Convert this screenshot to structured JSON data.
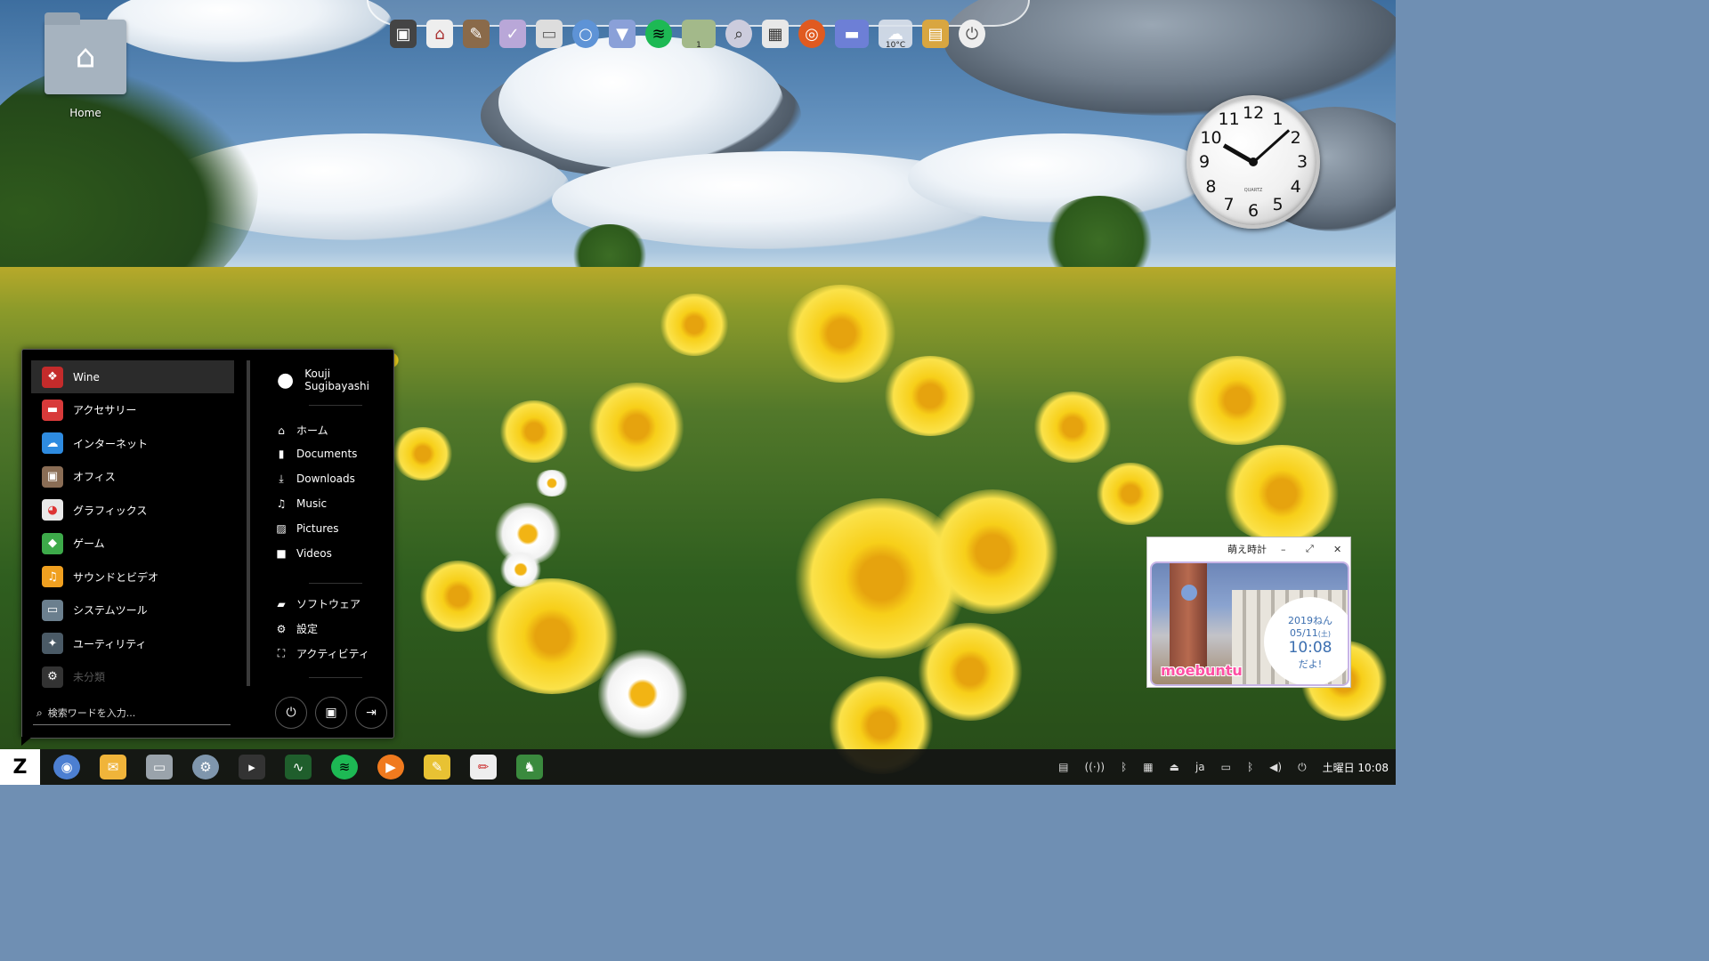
{
  "desktop": {
    "home_label": "Home",
    "home_icon": "house-icon"
  },
  "dock": {
    "weather_temp": "10°C",
    "workspace_number": "1",
    "icons": [
      "screenshot-icon",
      "home-icon",
      "gimp-icon",
      "tasks-icon",
      "hdd-icon",
      "search-icon",
      "shield-icon",
      "spotify-icon",
      "workspace-icon",
      "magnifier-icon",
      "calendar-icon",
      "ubuntu-icon",
      "panel-icon",
      "weather-icon",
      "archive-icon",
      "power-icon"
    ]
  },
  "analog_clock": {
    "numerals": [
      "12",
      "1",
      "2",
      "3",
      "4",
      "5",
      "6",
      "7",
      "8",
      "9",
      "10",
      "11"
    ],
    "brand": "QUARTZ"
  },
  "app_menu": {
    "categories": [
      {
        "label": "Wine",
        "icon": "wine-icon",
        "color": "#c42b2b"
      },
      {
        "label": "アクセサリー",
        "icon": "accessories-icon",
        "color": "#d83a3a"
      },
      {
        "label": "インターネット",
        "icon": "internet-cloud-icon",
        "color": "#2e8be0"
      },
      {
        "label": "オフィス",
        "icon": "office-briefcase-icon",
        "color": "#8a6d55"
      },
      {
        "label": "グラフィックス",
        "icon": "graphics-palette-icon",
        "color": "#e9e9e9"
      },
      {
        "label": "ゲーム",
        "icon": "game-controller-icon",
        "color": "#3daa4a"
      },
      {
        "label": "サウンドとビデオ",
        "icon": "sound-video-icon",
        "color": "#f0a020"
      },
      {
        "label": "システムツール",
        "icon": "monitor-icon",
        "color": "#6b7f8e"
      },
      {
        "label": "ユーティリティ",
        "icon": "utilities-icon",
        "color": "#4a5a66"
      },
      {
        "label": "未分類",
        "icon": "gear-icon",
        "color": "#333333"
      }
    ],
    "search_placeholder": "検索ワードを入力...",
    "user_name": "Kouji Sugibayashi",
    "places": [
      {
        "label": "ホーム",
        "icon": "home-icon"
      },
      {
        "label": "Documents",
        "icon": "document-icon"
      },
      {
        "label": "Downloads",
        "icon": "download-icon"
      },
      {
        "label": "Music",
        "icon": "music-note-icon"
      },
      {
        "label": "Pictures",
        "icon": "picture-icon"
      },
      {
        "label": "Videos",
        "icon": "video-camera-icon"
      }
    ],
    "system_items": [
      {
        "label": "ソフトウェア",
        "icon": "software-bag-icon"
      },
      {
        "label": "設定",
        "icon": "settings-gear-icon"
      },
      {
        "label": "アクティビティ",
        "icon": "activities-icon"
      }
    ],
    "power_buttons": [
      "power-icon",
      "lock-icon",
      "logout-icon"
    ]
  },
  "moe_clock": {
    "title": "萌え時計",
    "year": "2019ねん",
    "date": "05/11",
    "weekday": "(土)",
    "time": "10:08",
    "suffix": "だよ!",
    "logo": "moebuntu"
  },
  "taskbar": {
    "start_label": "Z",
    "apps": [
      "chromium-icon",
      "mail-icon",
      "files-icon",
      "settings-icon",
      "terminal-icon",
      "system-monitor-icon",
      "spotify-icon",
      "media-player-icon",
      "notes-icon",
      "text-editor-icon",
      "game-icon"
    ],
    "tray": {
      "ime_label": "ja",
      "clock": "土曜日 10:08"
    }
  }
}
